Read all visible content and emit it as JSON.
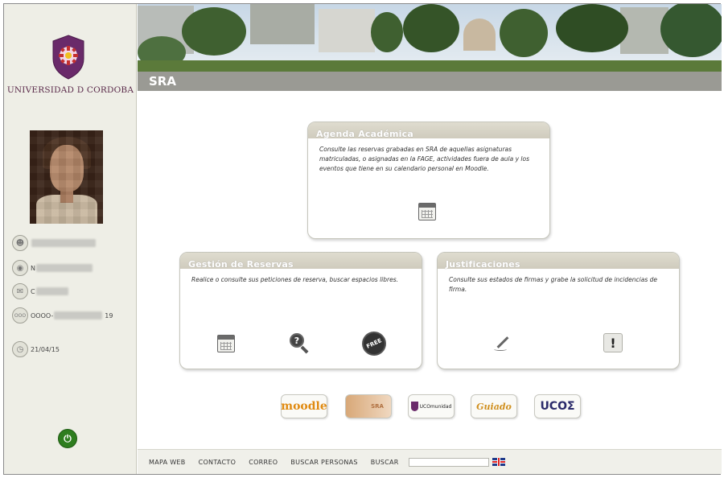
{
  "sidebar": {
    "university": "UNIVERSIDAD D CORDOBA",
    "info_rows": [
      {
        "icon": "user-icon",
        "text": "",
        "tail": ""
      },
      {
        "icon": "id-card-icon",
        "text": "N",
        "tail": ""
      },
      {
        "icon": "email-icon",
        "text": "C",
        "tail": ""
      },
      {
        "icon": "code-icon",
        "text": "OOOO-",
        "tail": "19"
      },
      {
        "icon": "date-icon",
        "text": "21/04/15",
        "tail": ""
      }
    ],
    "logout_icon": "power-icon"
  },
  "header": {
    "section_title": "SRA"
  },
  "cards": {
    "agenda": {
      "title": "Agenda Académica",
      "description": "Consulte las reservas grabadas en SRA de aquellas asignaturas matriculadas, o asignadas en la FAGE, actividades fuera de aula y los eventos que tiene en su calendario personal en Moodle.",
      "icons": [
        "calendar-grid-icon"
      ]
    },
    "reservas": {
      "title": "Gestión de Reservas",
      "description": "Realice o consulte sus peticiones de reserva, buscar espacios libres.",
      "icons": [
        "calendar-icon",
        "search-icon",
        "free-icon"
      ]
    },
    "justificaciones": {
      "title": "Justificaciones",
      "description": "Consulte sus estados de firmas y grabe la solicitud de incidencias de firma.",
      "icons": [
        "signature-pen-icon",
        "warning-icon"
      ]
    }
  },
  "partners": [
    "moodle",
    "SRA",
    "UCOmunidad",
    "Guiado",
    "UCOΣ"
  ],
  "footer": {
    "links": [
      "MAPA WEB",
      "CONTACTO",
      "CORREO",
      "BUSCAR PERSONAS",
      "BUSCAR"
    ],
    "search_value": "",
    "language_icon": "uk-flag-icon"
  },
  "colors": {
    "sra_bar": "#9a9a94",
    "card_header": "#d6d2c4",
    "sidebar_bg": "#eeeee6",
    "logout_green": "#2e7d1e",
    "university_purple": "#5a2a4a"
  }
}
